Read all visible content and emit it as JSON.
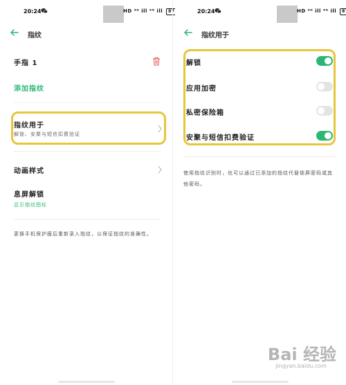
{
  "status_bar": {
    "time": "20:24",
    "hd": "HD",
    "signal": "⁴ᴳ ill ⁴ᴳ ill",
    "battery": "87"
  },
  "left": {
    "title": "指纹",
    "fingerprint_1": "手指 1",
    "add_fingerprint": "添加指纹",
    "fingerprint_for": {
      "label": "指纹用于",
      "sub": "解锁、安聚与短信扣费验证"
    },
    "animation_style": "动画样式",
    "screen_off_unlock": {
      "label": "息屏解锁",
      "sub": "显示指纹图标"
    },
    "note": "更换手机保护膜后重新录入指纹，以保证指纹的准确性。"
  },
  "right": {
    "title": "指纹用于",
    "options": [
      {
        "label": "解锁",
        "on": true
      },
      {
        "label": "应用加密",
        "on": false
      },
      {
        "label": "私密保险箱",
        "on": false
      },
      {
        "label": "安聚与短信扣费验证",
        "on": true
      }
    ],
    "note": "使用指纹识别时，也可以通过已添加的指纹代替锁屏密码或其他密码。"
  },
  "colors": {
    "accent": "#2bb673",
    "highlight": "#e8c53a",
    "delete": "#e05050"
  },
  "watermark": {
    "logo": "Bai 经验",
    "url": "jingyan.baidu.com"
  }
}
